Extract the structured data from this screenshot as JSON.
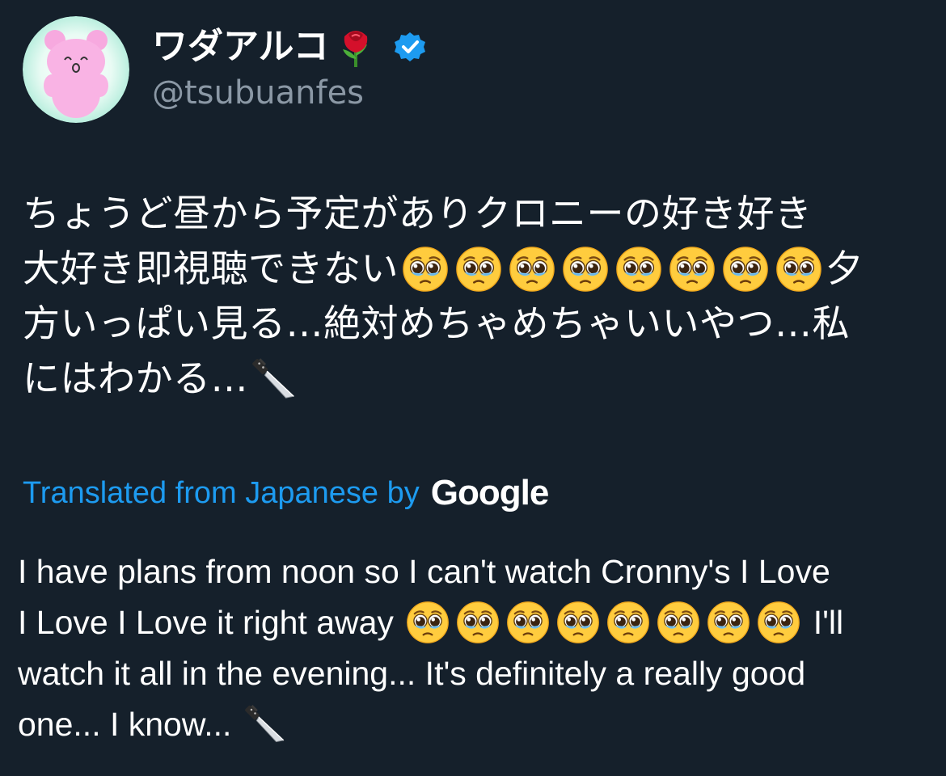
{
  "author": {
    "display_name": "ワダアルコ",
    "name_emoji": "rose",
    "verified_icon": "verified-badge-icon",
    "handle": "@tsubuanfes"
  },
  "tweet": {
    "lines": [
      [
        "ちょうど昼から予定がありクロニーの好き好き"
      ],
      [
        "大好き即視聴できない",
        "pleading-face",
        "pleading-face",
        "pleading-face",
        "pleading-face",
        "pleading-face",
        "pleading-face",
        "pleading-face",
        "pleading-face",
        "夕"
      ],
      [
        "方いっぱい見る…絶対めちゃめちゃいいやつ…私"
      ],
      [
        "にはわかる…",
        "kitchen-knife"
      ]
    ]
  },
  "translation_header": {
    "label": "Translated from Japanese by",
    "provider": "Google"
  },
  "translation": {
    "lines": [
      [
        "I have plans from noon so I can't watch Cronny's I Love"
      ],
      [
        "I Love I Love it right away ",
        "pleading-face",
        "pleading-face",
        "pleading-face",
        "pleading-face",
        "pleading-face",
        "pleading-face",
        "pleading-face",
        "pleading-face",
        " I'll"
      ],
      [
        "watch it all in the evening... It's definitely a really good"
      ],
      [
        "one... I know... ",
        "kitchen-knife"
      ]
    ]
  },
  "colors": {
    "background": "#15202b",
    "text": "#ffffff",
    "secondary_text": "#8b98a5",
    "accent": "#1d9bf0"
  }
}
